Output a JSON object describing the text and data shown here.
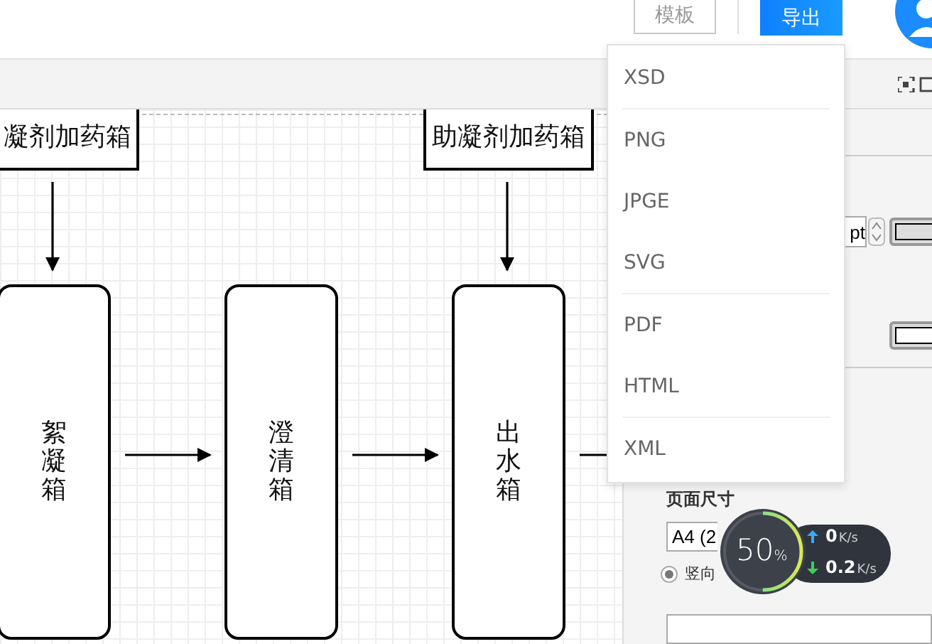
{
  "header": {
    "template_button": "模板",
    "export_button": "导出"
  },
  "export_menu": {
    "items": [
      {
        "label": "XSD",
        "divider_after": true
      },
      {
        "label": "PNG",
        "divider_after": false
      },
      {
        "label": "JPGE",
        "divider_after": false
      },
      {
        "label": "SVG",
        "divider_after": true
      },
      {
        "label": "PDF",
        "divider_after": false
      },
      {
        "label": "HTML",
        "divider_after": true
      },
      {
        "label": "XML",
        "divider_after": false
      }
    ]
  },
  "diagram": {
    "nodes": [
      {
        "label": "凝剂加药箱",
        "kind": "wide"
      },
      {
        "label": "助凝剂加药箱",
        "kind": "wide"
      },
      {
        "label": "絮凝箱",
        "kind": "tall"
      },
      {
        "label": "澄清箱",
        "kind": "tall"
      },
      {
        "label": "出水箱",
        "kind": "tall"
      }
    ]
  },
  "panel": {
    "line_width_unit": "pt",
    "page_size_label": "页面尺寸",
    "page_size_value": "A4 (2",
    "orientation": [
      {
        "label": "竖向",
        "selected": true
      }
    ]
  },
  "speed_widget": {
    "percent": "50",
    "percent_unit": "%",
    "level": 0.5,
    "upload": "0",
    "upload_unit": "K/s",
    "download": "0.2",
    "download_unit": "K/s"
  }
}
